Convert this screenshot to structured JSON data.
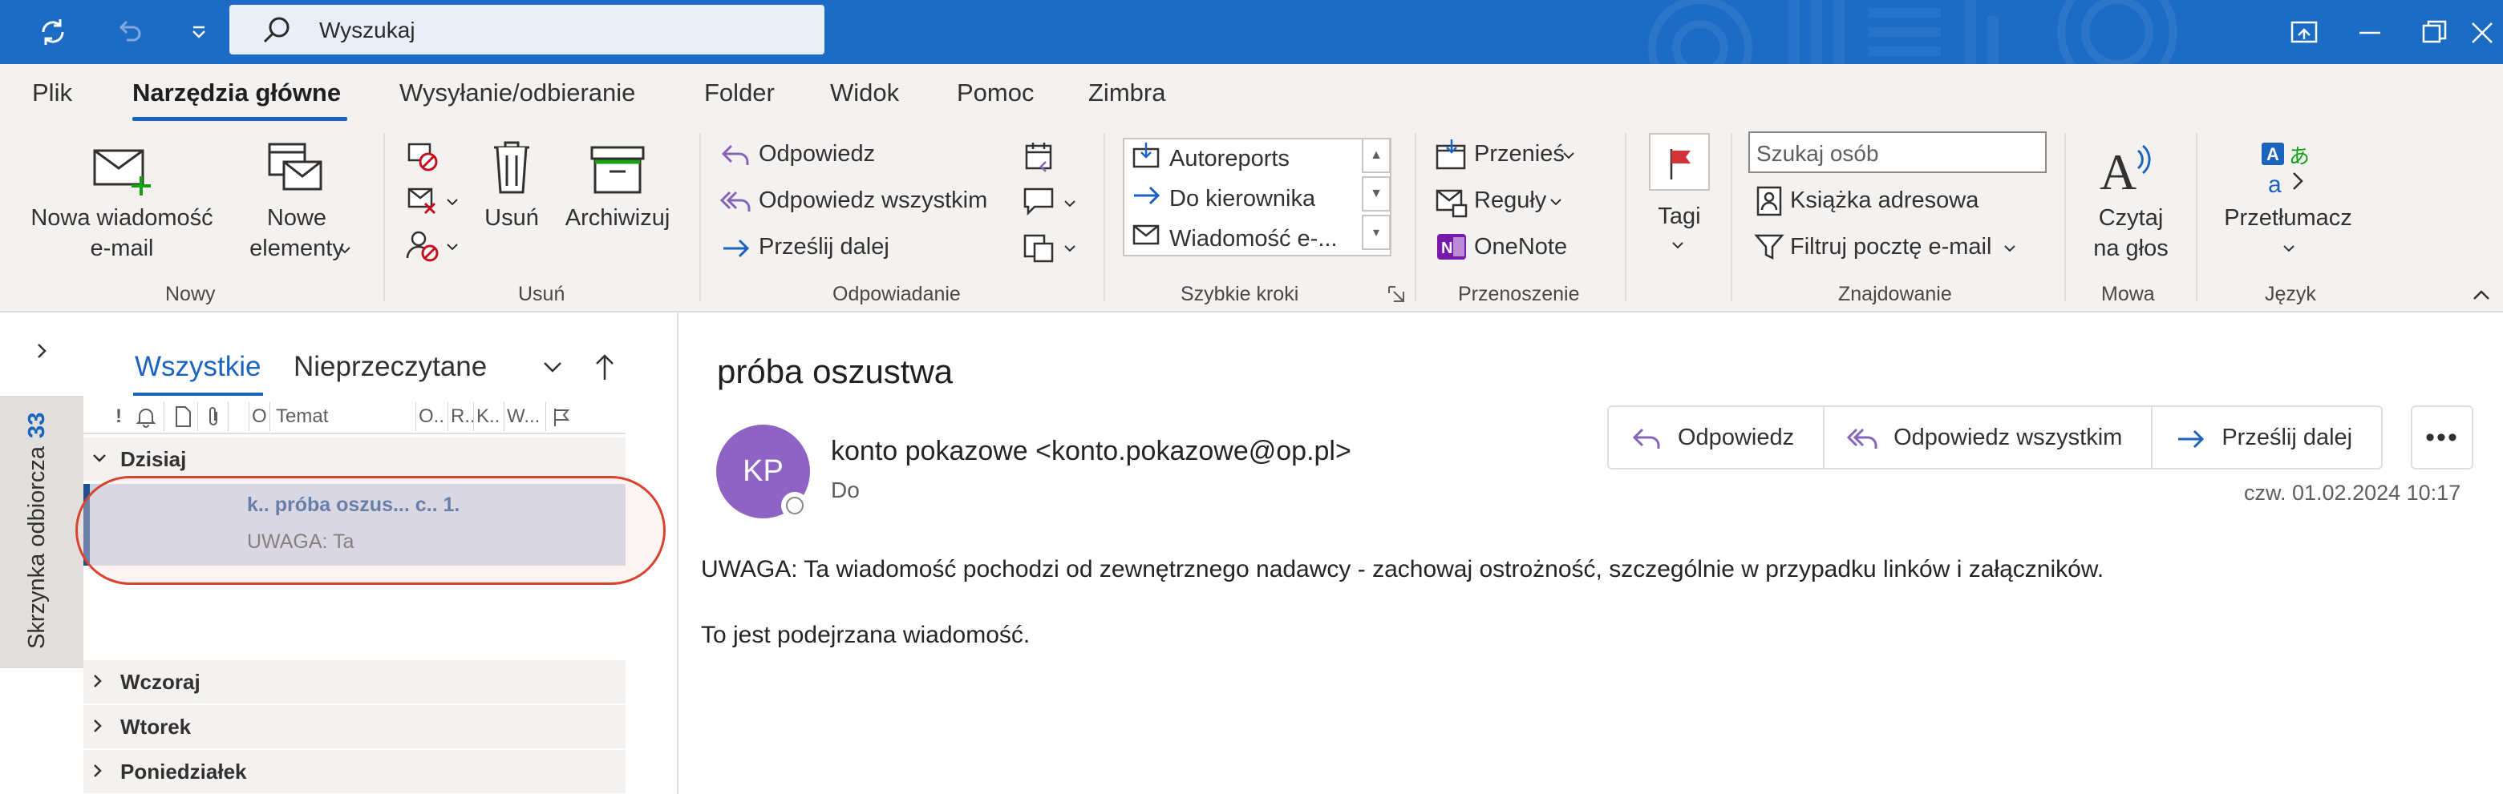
{
  "titlebar": {
    "search_placeholder": "Wyszukaj"
  },
  "ribbon_tabs": [
    "Plik",
    "Narzędzia główne",
    "Wysyłanie/odbieranie",
    "Folder",
    "Widok",
    "Pomoc",
    "Zimbra"
  ],
  "ribbon": {
    "nowy": {
      "new_mail": [
        "Nowa wiadomość",
        "e-mail"
      ],
      "new_items": [
        "Nowe",
        "elementy"
      ],
      "label": "Nowy"
    },
    "usun": {
      "delete": "Usuń",
      "archive": "Archiwizuj",
      "label": "Usuń"
    },
    "odpowiadanie": {
      "reply": "Odpowiedz",
      "reply_all": "Odpowiedz wszystkim",
      "forward": "Prześlij dalej",
      "label": "Odpowiadanie"
    },
    "szybkie_kroki": {
      "items": [
        "Autoreports",
        "Do kierownika",
        "Wiadomość e-..."
      ],
      "label": "Szybkie kroki"
    },
    "przenoszenie": {
      "move": "Przenieś",
      "rules": "Reguły",
      "onenote": "OneNote",
      "label": "Przenoszenie"
    },
    "tagi": {
      "label_btn": "Tagi"
    },
    "znajdowanie": {
      "people_search_placeholder": "Szukaj osób",
      "address_book": "Książka adresowa",
      "filter_mail": "Filtruj pocztę e-mail",
      "label": "Znajdowanie"
    },
    "mowa": {
      "read_aloud": [
        "Czytaj",
        "na głos"
      ],
      "label": "Mowa"
    },
    "jezyk": {
      "translate": "Przetłumacz",
      "label": "Język"
    }
  },
  "nav": {
    "folder_label": "Skrzynka odbiorcza",
    "unread_count": "33"
  },
  "message_list": {
    "tabs": [
      "Wszystkie",
      "Nieprzeczytane"
    ],
    "columns": [
      "!",
      "O",
      "Temat",
      "O..",
      "R..",
      "K..",
      "W..."
    ],
    "groups": [
      "Dzisiaj",
      "Wczoraj",
      "Wtorek",
      "Poniedziałek"
    ],
    "selected_message": {
      "subject_line": "k.. próba oszus...  c..  1.",
      "preview": "UWAGA: Ta"
    }
  },
  "reading_pane": {
    "subject": "próba oszustwa",
    "avatar_initials": "KP",
    "sender": "konto pokazowe <konto.pokazowe@op.pl>",
    "to_label": "Do",
    "actions": [
      "Odpowiedz",
      "Odpowiedz wszystkim",
      "Prześlij dalej"
    ],
    "more": "•••",
    "datetime": "czw. 01.02.2024 10:17",
    "body": [
      "UWAGA: Ta wiadomość pochodzi od zewnętrznego nadawcy - zachowaj ostrożność, szczególnie w przypadku linków i załączników.",
      "To jest podejrzana wiadomość."
    ]
  },
  "colors": {
    "titlebar": "#1c6bc4",
    "accent": "#1a64bd",
    "selection": "#c7d2e6",
    "highlight_ring": "#d8442e",
    "avatar": "#8e63c4"
  }
}
